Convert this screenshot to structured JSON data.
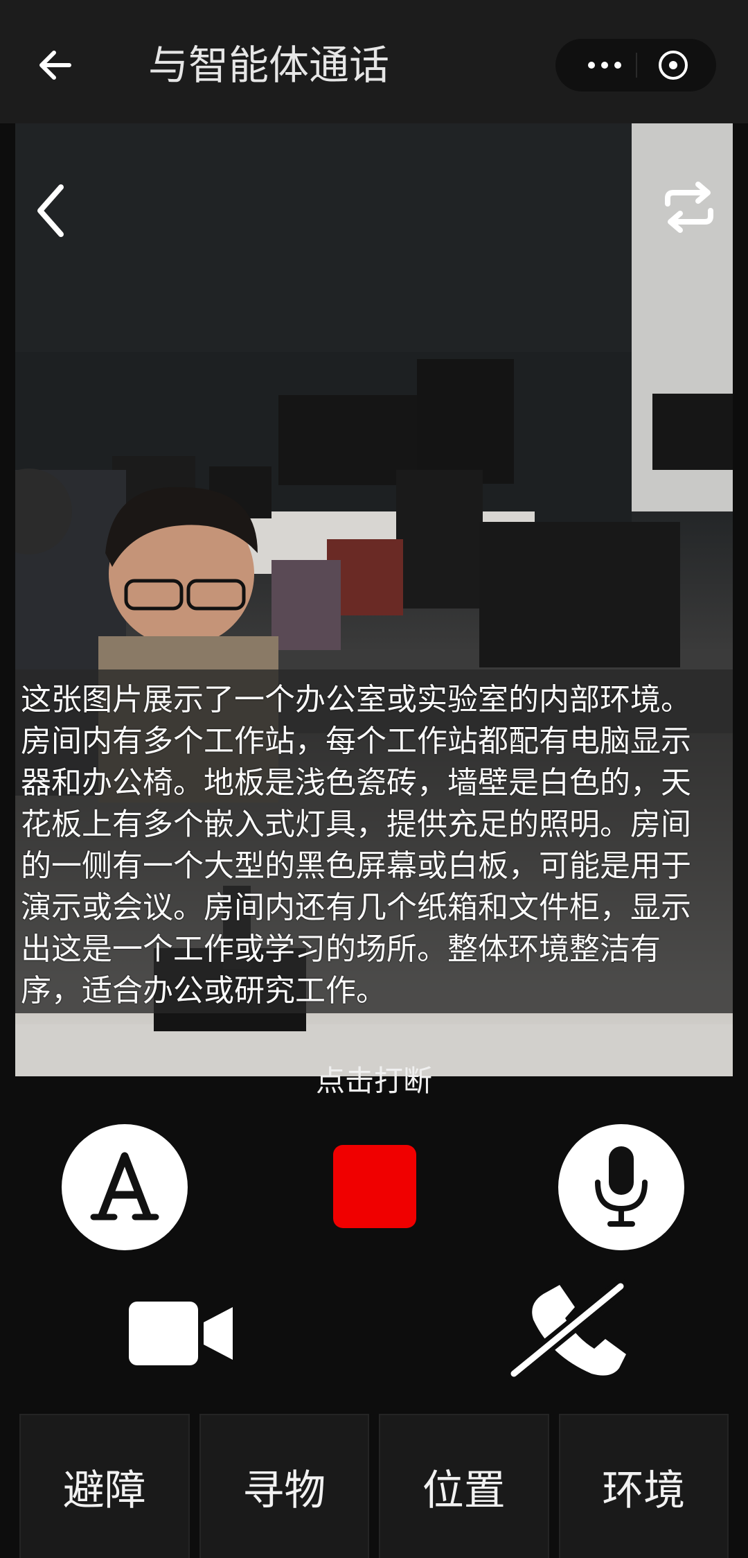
{
  "header": {
    "title": "与智能体通话"
  },
  "caption": {
    "text": "这张图片展示了一个办公室或实验室的内部环境。房间内有多个工作站，每个工作站都配有电脑显示器和办公椅。地板是浅色瓷砖，墙壁是白色的，天花板上有多个嵌入式灯具，提供充足的照明。房间的一侧有一个大型的黑色屏幕或白板，可能是用于演示或会议。房间内还有几个纸箱和文件柜，显示出这是一个工作或学习的场所。整体环境整洁有序，适合办公或研究工作。"
  },
  "call": {
    "interrupt_hint": "点击打断"
  },
  "modes": [
    {
      "label": "避障"
    },
    {
      "label": "寻物"
    },
    {
      "label": "位置"
    },
    {
      "label": "环境"
    }
  ],
  "icons": {
    "header_back": "arrow-left-icon",
    "more": "more-dots-icon",
    "close": "close-circle-icon",
    "camera_back": "chevron-left-icon",
    "camera_switch": "switch-camera-icon",
    "text_mode": "letter-a-icon",
    "microphone": "microphone-icon",
    "video": "video-camera-icon",
    "hangup": "phone-off-icon"
  },
  "colors": {
    "stop": "#f00000",
    "background": "#0d0d0d",
    "header": "#1c1c1c"
  }
}
